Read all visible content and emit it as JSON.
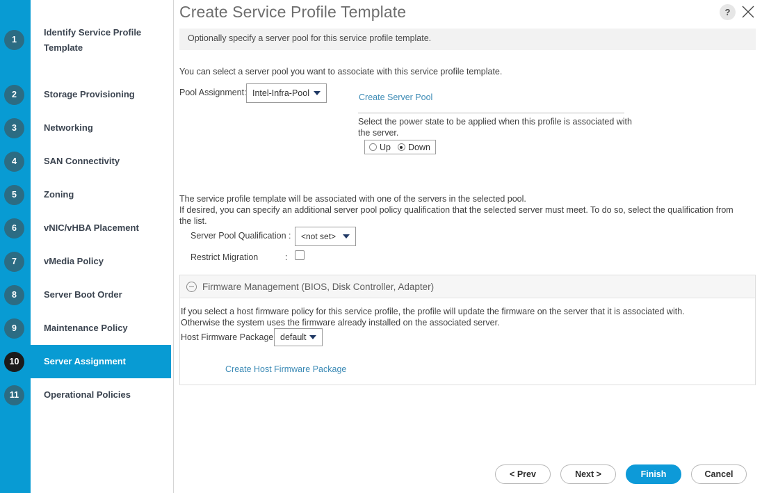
{
  "dialog": {
    "title": "Create Service Profile Template",
    "help_icon_label": "?",
    "help_icon_name": "help-icon",
    "close_icon_name": "close-icon",
    "subheader": "Optionally specify a server pool for this service profile template."
  },
  "sidebar": {
    "steps": [
      {
        "number": "1",
        "label": "Identify Service Profile Template",
        "active": false
      },
      {
        "number": "2",
        "label": "Storage Provisioning",
        "active": false
      },
      {
        "number": "3",
        "label": "Networking",
        "active": false
      },
      {
        "number": "4",
        "label": "SAN Connectivity",
        "active": false
      },
      {
        "number": "5",
        "label": "Zoning",
        "active": false
      },
      {
        "number": "6",
        "label": "vNIC/vHBA Placement",
        "active": false
      },
      {
        "number": "7",
        "label": "vMedia Policy",
        "active": false
      },
      {
        "number": "8",
        "label": "Server Boot Order",
        "active": false
      },
      {
        "number": "9",
        "label": "Maintenance Policy",
        "active": false
      },
      {
        "number": "10",
        "label": "Server Assignment",
        "active": true
      },
      {
        "number": "11",
        "label": "Operational Policies",
        "active": false
      }
    ]
  },
  "main": {
    "intro_text": "You can select a server pool you want to associate with this service profile template.",
    "pool_assignment_label": "Pool Assignment:",
    "pool_assignment_value": "Intel-Infra-Pool",
    "create_server_pool_link": "Create Server Pool",
    "power_state_desc": "Select the power state to be applied when this profile is associated with the server.",
    "power_state_options": [
      {
        "label": "Up",
        "selected": false
      },
      {
        "label": "Down",
        "selected": true
      }
    ],
    "association_text": "The service profile template will be associated with one of the servers in the selected pool. If desired, you can specify an additional server pool policy qualification that the selected server must meet. To do so, select the qualification from the list.",
    "association_line1": "The service profile template will be associated with one of the servers in the selected pool.",
    "association_line2": "If desired, you can specify an additional server pool policy qualification that the selected server must meet. To do so, select the qualification from",
    "association_line3": "the list.",
    "server_pool_qualification_label": "Server Pool Qualification :",
    "server_pool_qualification_value": "<not set>",
    "restrict_migration_label": "Restrict Migration",
    "restrict_migration_colon": ":",
    "restrict_migration_checked": false
  },
  "firmware": {
    "panel_title": "Firmware Management (BIOS, Disk Controller, Adapter)",
    "collapse_icon_name": "minus-circle-icon",
    "desc_line1": "If you select a host firmware policy for this service profile, the profile will update the firmware on the server that it is associated with.",
    "desc_line2": "Otherwise the system uses the firmware already installed on the associated server.",
    "host_firmware_package_label": "Host Firmware Package:",
    "host_firmware_package_value": "default",
    "create_host_firmware_package_link": "Create Host Firmware Package"
  },
  "footer": {
    "prev_label": "< Prev",
    "next_label": "Next >",
    "finish_label": "Finish",
    "cancel_label": "Cancel"
  },
  "colors": {
    "accent_blue": "#089bd3",
    "badge_teal": "#2c6c83",
    "badge_active": "#1b1b1b",
    "link_blue": "#3b8ab5",
    "primary_button": "#0d9ad8"
  }
}
